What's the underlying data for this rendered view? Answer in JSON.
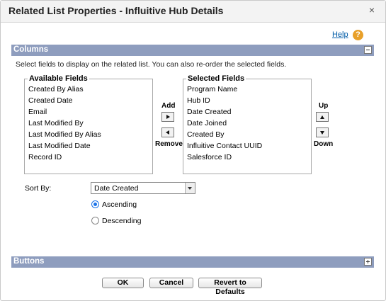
{
  "dialog": {
    "title": "Related List Properties - Influitive Hub Details",
    "close_glyph": "×",
    "help_label": "Help",
    "help_icon_glyph": "?"
  },
  "columns": {
    "title": "Columns",
    "instructions": "Select fields to display on the related list. You can also re-order the selected fields.",
    "available_legend": "Available Fields",
    "available": [
      "Created By Alias",
      "Created Date",
      "Email",
      "Last Modified By",
      "Last Modified By Alias",
      "Last Modified Date",
      "Record ID"
    ],
    "selected_legend": "Selected Fields",
    "selected": [
      "Program Name",
      "Hub ID",
      "Date Created",
      "Date Joined",
      "Created By",
      "Influitive Contact UUID",
      "Salesforce ID"
    ],
    "add_label": "Add",
    "remove_label": "Remove",
    "up_label": "Up",
    "down_label": "Down"
  },
  "sort": {
    "label": "Sort By:",
    "value": "Date Created",
    "ascending_label": "Ascending",
    "descending_label": "Descending",
    "ascending_checked": true
  },
  "buttons_section": {
    "title": "Buttons"
  },
  "footer": {
    "ok_label": "OK",
    "cancel_label": "Cancel",
    "revert_label": "Revert to Defaults"
  },
  "colors": {
    "section_bar": "#8e9dbe",
    "help_link": "#015ba7",
    "help_icon": "#e8a02a",
    "radio_accent": "#1a73e8"
  }
}
